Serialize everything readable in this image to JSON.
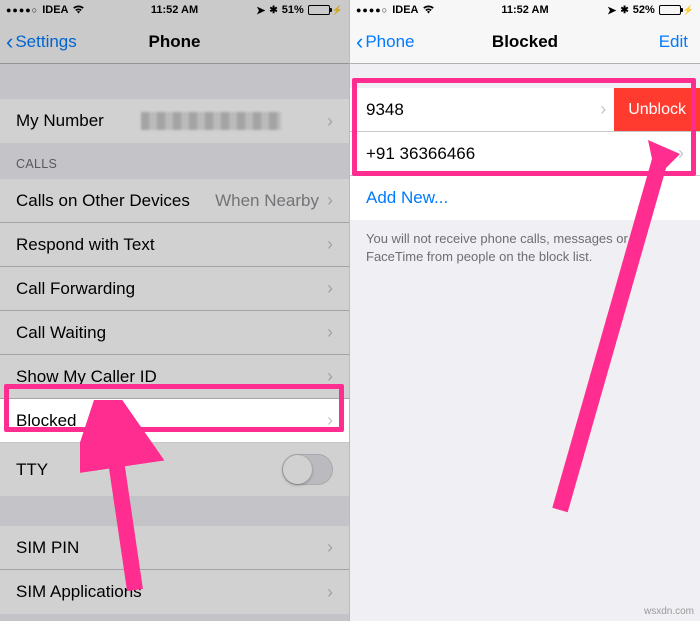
{
  "left": {
    "status": {
      "carrier": "IDEA",
      "time": "11:52 AM",
      "battery_pct": "51%",
      "battery_fill": 51
    },
    "nav": {
      "back": "Settings",
      "title": "Phone"
    },
    "sections": {
      "my_number_label": "My Number",
      "calls_header": "CALLS",
      "rows": {
        "other_devices": {
          "label": "Calls on Other Devices",
          "value": "When Nearby"
        },
        "respond": {
          "label": "Respond with Text"
        },
        "forwarding": {
          "label": "Call Forwarding"
        },
        "waiting": {
          "label": "Call Waiting"
        },
        "caller_id": {
          "label": "Show My Caller ID"
        },
        "blocked": {
          "label": "Blocked"
        },
        "tty": {
          "label": "TTY"
        },
        "sim_pin": {
          "label": "SIM PIN"
        },
        "sim_apps": {
          "label": "SIM Applications"
        }
      }
    }
  },
  "right": {
    "status": {
      "carrier": "IDEA",
      "time": "11:52 AM",
      "battery_pct": "52%",
      "battery_fill": 52
    },
    "nav": {
      "back": "Phone",
      "title": "Blocked",
      "edit": "Edit"
    },
    "rows": {
      "num1": {
        "label": "9348",
        "action": "Unblock"
      },
      "num2": {
        "label": "+91 36366466"
      },
      "add": {
        "label": "Add New..."
      }
    },
    "note": "You will not receive phone calls, messages or FaceTime from people on the block list."
  },
  "watermark": "wsxdn.com"
}
